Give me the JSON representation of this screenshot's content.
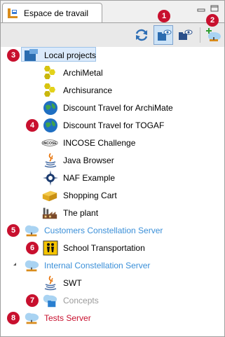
{
  "window": {
    "tab_title": "Espace de travail"
  },
  "toolbar": {
    "buttons": [
      {
        "icon": "refresh-icon"
      },
      {
        "icon": "show-local-projects-icon",
        "pressed": true
      },
      {
        "icon": "show-server-projects-icon"
      },
      {
        "icon": "add-server-icon"
      }
    ]
  },
  "badges": [
    "1",
    "2",
    "3",
    "4",
    "5",
    "6",
    "7",
    "8"
  ],
  "tree": {
    "local_projects": "Local projects",
    "local_items": [
      {
        "label": "ArchiMetal",
        "icon": "hexagon-icon"
      },
      {
        "label": "Archisurance",
        "icon": "hexagon-icon"
      },
      {
        "label": "Discount Travel for ArchiMate",
        "icon": "globe-icon"
      },
      {
        "label": "Discount Travel for TOGAF",
        "icon": "globe-icon"
      },
      {
        "label": "INCOSE Challenge",
        "icon": "incose-logo"
      },
      {
        "label": "Java Browser",
        "icon": "java-icon"
      },
      {
        "label": "NAF Example",
        "icon": "naf-star-icon"
      },
      {
        "label": "Shopping Cart",
        "icon": "shopping-cart-icon"
      },
      {
        "label": "The plant",
        "icon": "factory-icon"
      }
    ],
    "servers": [
      {
        "label": "Customers Constellation Server",
        "children": [
          {
            "label": "School Transportation",
            "icon": "school-bus-icon"
          }
        ]
      },
      {
        "label": "Internal Constellation Server",
        "children": [
          {
            "label": "SWT",
            "icon": "java-icon"
          },
          {
            "label": "Concepts",
            "icon": "cloud-folder-icon"
          }
        ]
      },
      {
        "label": "Tests Server",
        "children": []
      }
    ]
  },
  "colors": {
    "link": "#3a8fd8",
    "badge": "#c8102e",
    "muted": "#9a9a9a",
    "selection": "#dbeafb"
  }
}
